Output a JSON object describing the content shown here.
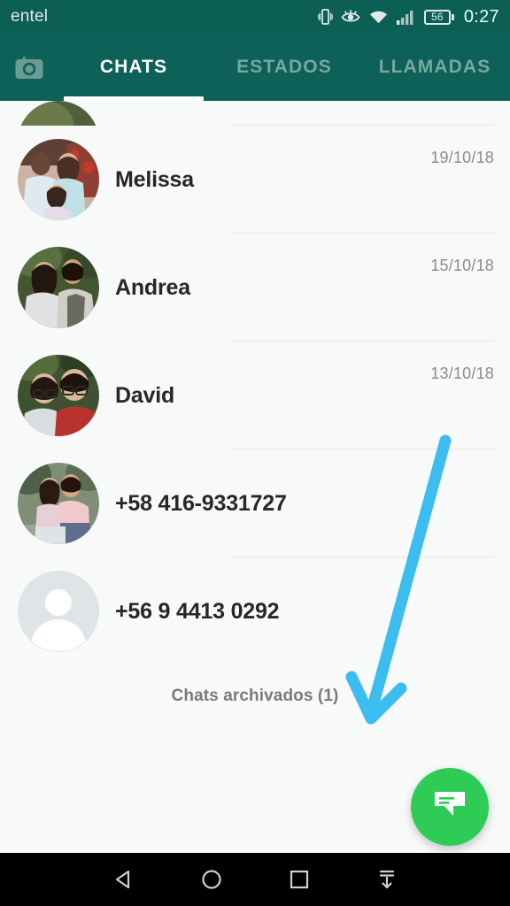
{
  "status_bar": {
    "carrier": "entel",
    "battery_level": "56",
    "clock": "0:27",
    "icons": [
      "vibrate-icon",
      "eye-icon",
      "wifi-icon",
      "signal-icon",
      "battery-icon"
    ]
  },
  "tabs": {
    "camera_icon": "camera-icon",
    "items": [
      {
        "label": "CHATS",
        "active": true
      },
      {
        "label": "ESTADOS",
        "active": false
      },
      {
        "label": "LLAMADAS",
        "active": false
      }
    ]
  },
  "chats": [
    {
      "name": "",
      "date": "",
      "avatar": "photo",
      "partial": true
    },
    {
      "name": "Melissa",
      "date": "19/10/18",
      "avatar": "photo"
    },
    {
      "name": "Andrea",
      "date": "15/10/18",
      "avatar": "photo"
    },
    {
      "name": "David",
      "date": "13/10/18",
      "avatar": "photo"
    },
    {
      "name": "+58 416-9331727",
      "date": "",
      "avatar": "photo"
    },
    {
      "name": "+56 9 4413 0292",
      "date": "",
      "avatar": "default"
    }
  ],
  "archived": {
    "label": "Chats archivados (1)"
  },
  "fab": {
    "icon": "new-chat-icon"
  },
  "annotation": {
    "arrow_color": "#3cbdf0",
    "points_to": "Chats archivados (1)"
  },
  "nav_bar": {
    "buttons": [
      "back-icon",
      "home-icon",
      "recents-icon",
      "hide-navbar-icon"
    ]
  },
  "colors": {
    "header_green": "#0d6158",
    "status_green": "#0b5f55",
    "fab_green": "#2ecc56",
    "background": "#f8f9f9",
    "accent_arrow": "#3cbdf0"
  }
}
